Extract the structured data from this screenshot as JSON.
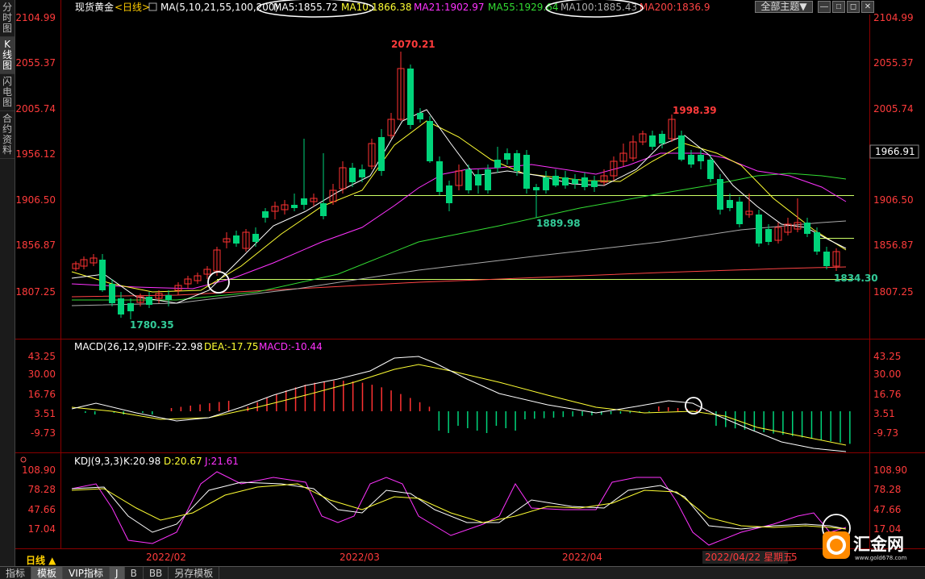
{
  "left_tabs": [
    "分时图",
    "K线图",
    "闪电图",
    "合约资料"
  ],
  "header": {
    "name": "现货黄金",
    "period": "<日线>",
    "ma_params": "MA(5,10,21,55,100,200)",
    "ma_values": [
      {
        "label": "MA5:1855.72",
        "color": "#ffffff"
      },
      {
        "label": "MA10:1866.38",
        "color": "#ffff33"
      },
      {
        "label": "MA21:1902.97",
        "color": "#ff33ff"
      },
      {
        "label": "MA55:1929.64",
        "color": "#33dd33"
      },
      {
        "label": "MA100:1885.43",
        "color": "#aaaaaa"
      },
      {
        "label": "MA200:1836.9",
        "color": "#ff4444"
      }
    ],
    "theme_button": "全部主题▼"
  },
  "price_axis": [
    "2104.99",
    "2055.37",
    "2005.74",
    "1956.12",
    "1906.50",
    "1856.87",
    "1807.25"
  ],
  "current_price": "1966.91",
  "annotations": {
    "high": "2070.21",
    "mid_high": "1998.39",
    "low": "1780.35",
    "mid_low": "1889.98",
    "last_low": "1834.30"
  },
  "macd": {
    "title": "MACD(26,12,9)",
    "diff": "DIFF:-22.98",
    "dea": "DEA:-17.75",
    "macd": "MACD:-10.44",
    "axis": [
      "43.25",
      "30.00",
      "16.76",
      "3.51",
      "-9.73"
    ]
  },
  "kdj": {
    "title": "KDJ(9,3,3)",
    "k": "K:20.98",
    "d": "D:20.67",
    "j": "J:21.61",
    "axis": [
      "108.90",
      "78.28",
      "47.66",
      "17.04"
    ]
  },
  "time_axis": [
    "2022/02",
    "2022/03",
    "2022/04"
  ],
  "time_cursor": "2022/04/22 星期五",
  "time_tail": "5",
  "period_label": "日线 ▲",
  "bottom_tabs": [
    "指标",
    "模板",
    "VIP指标",
    "J",
    "B",
    "BB",
    "另存模板"
  ],
  "watermark": {
    "name": "汇金网",
    "url": "www.gold678.com"
  },
  "colors": {
    "up": "#ff3232",
    "down": "#00d47a",
    "axis": "#ff3b3b",
    "grid": "#7a0000"
  }
}
